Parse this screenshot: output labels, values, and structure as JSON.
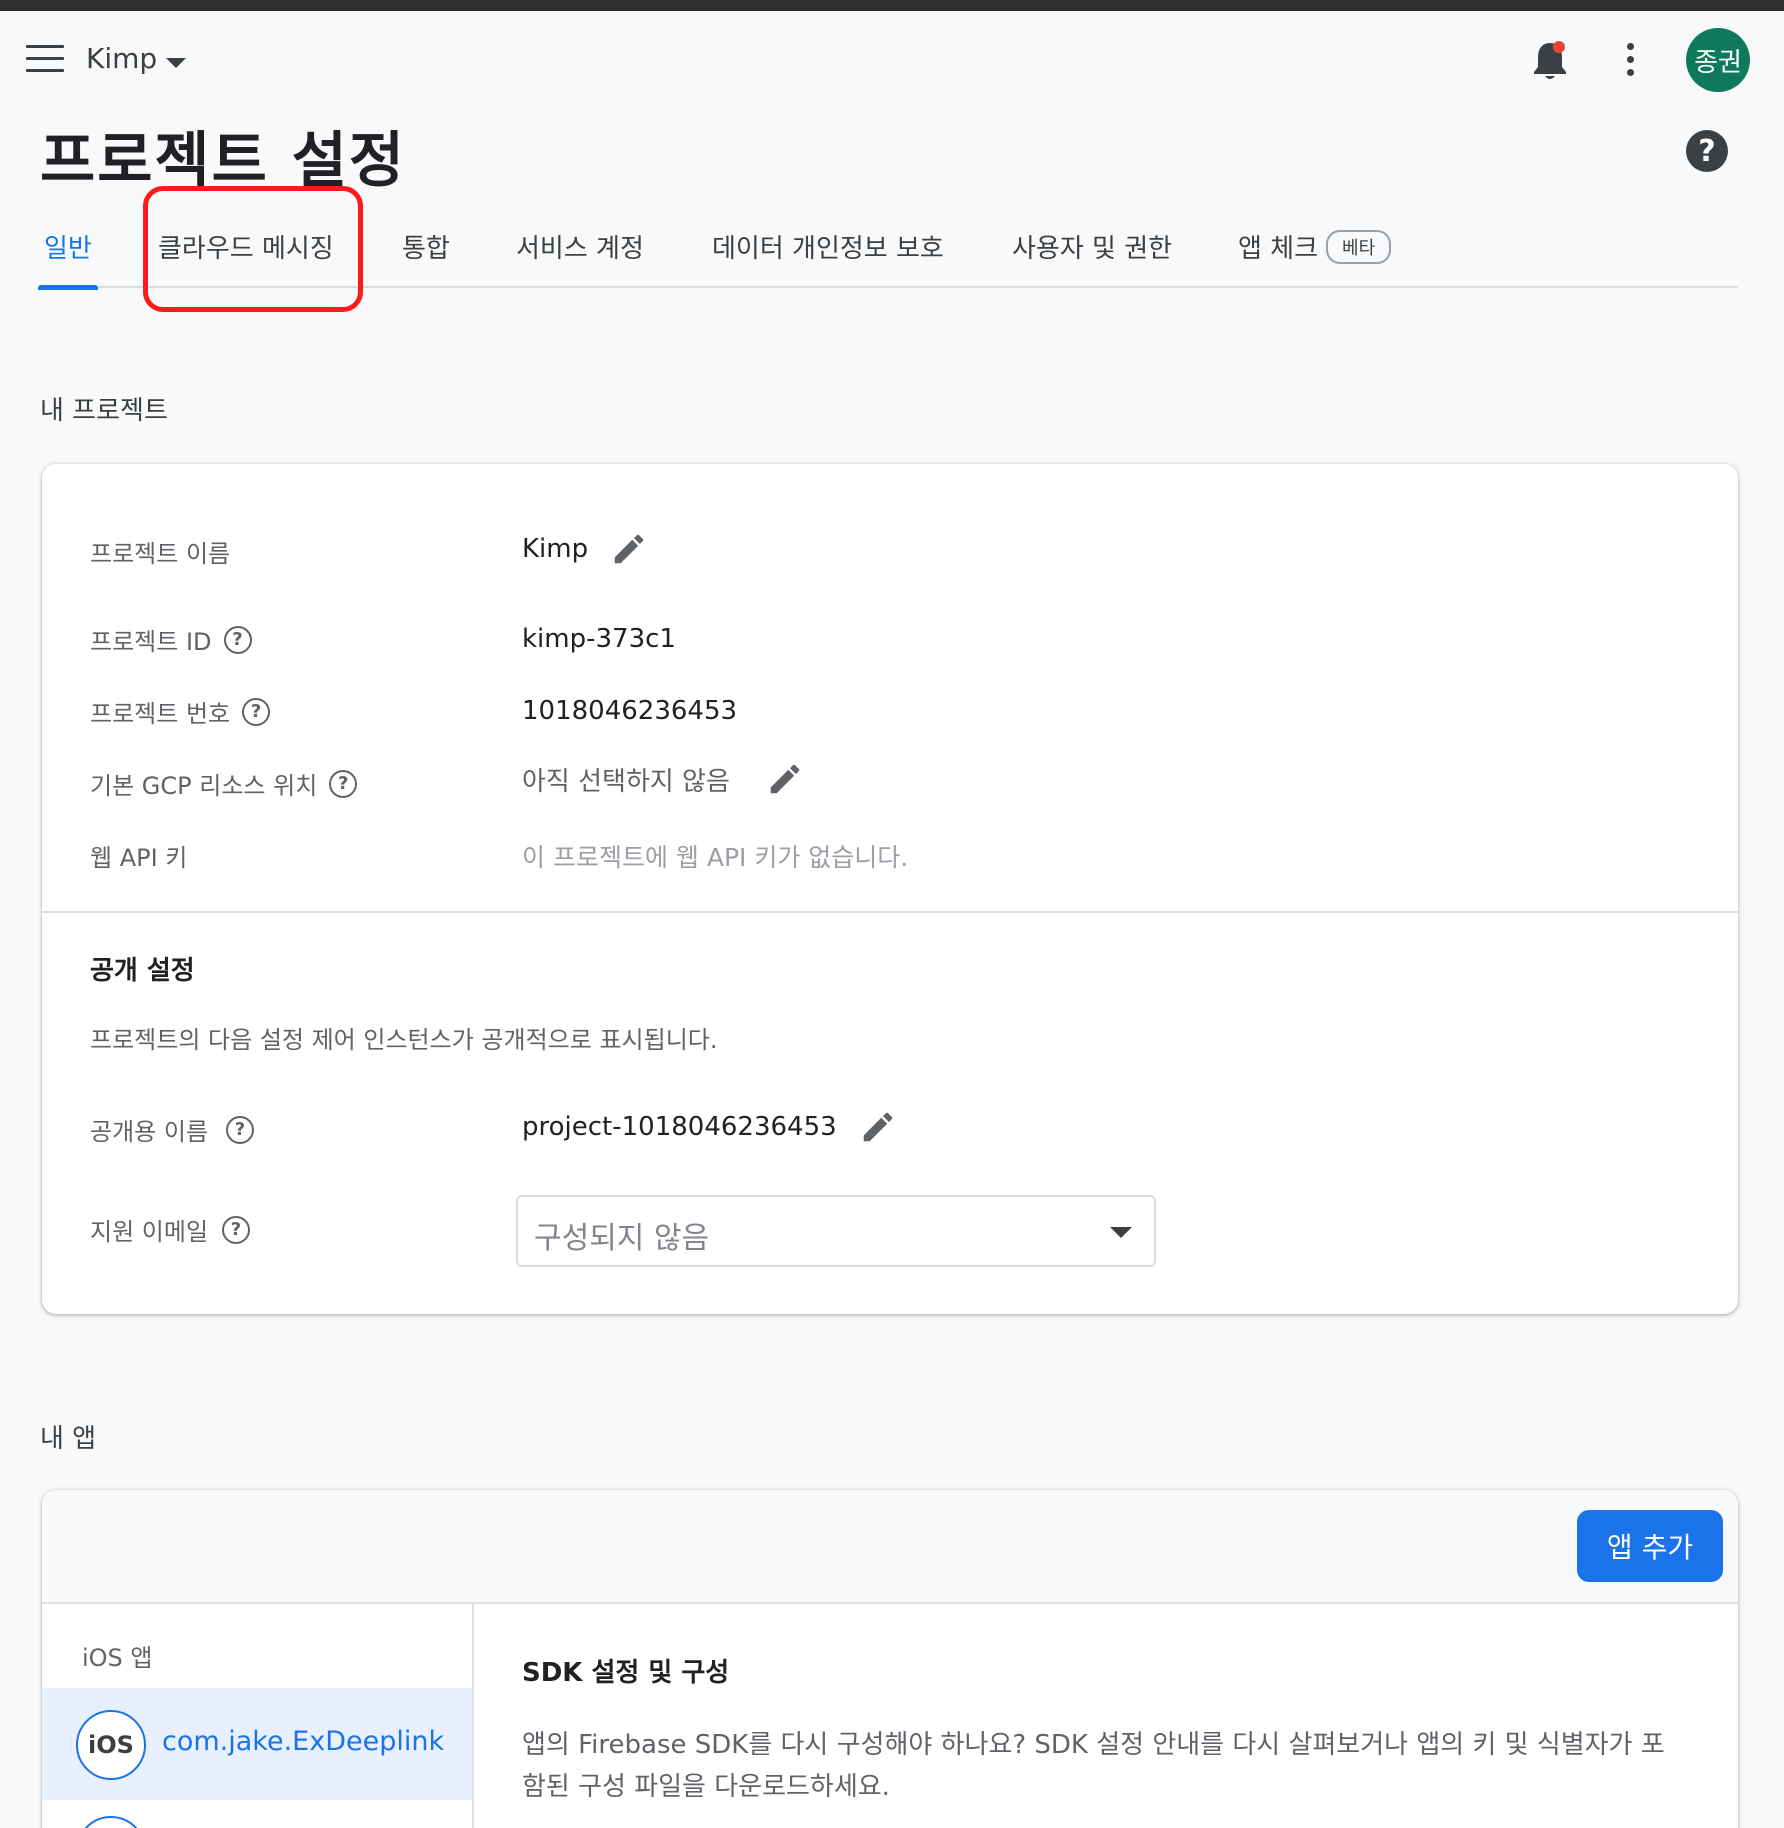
{
  "header": {
    "project_name": "Kimp",
    "avatar_text": "종권",
    "notification_dot_color": "#ea4335"
  },
  "page": {
    "title": "프로젝트 설정",
    "help_glyph": "?"
  },
  "tabs": [
    {
      "label": "일반",
      "active": true
    },
    {
      "label": "클라우드 메시징",
      "highlighted": true
    },
    {
      "label": "통합"
    },
    {
      "label": "서비스 계정"
    },
    {
      "label": "데이터 개인정보 보호"
    },
    {
      "label": "사용자 및 권한"
    },
    {
      "label": "앱 체크",
      "badge": "베타"
    }
  ],
  "my_project": {
    "section_label": "내 프로젝트",
    "rows": {
      "name": {
        "label": "프로젝트 이름",
        "value": "Kimp"
      },
      "id": {
        "label": "프로젝트 ID",
        "value": "kimp-373c1"
      },
      "number": {
        "label": "프로젝트 번호",
        "value": "1018046236453"
      },
      "gcp_location": {
        "label": "기본 GCP 리소스 위치",
        "value": "아직 선택하지 않음"
      },
      "web_api_key": {
        "label": "웹 API 키",
        "value": "이 프로젝트에 웹 API 키가 없습니다."
      }
    },
    "public": {
      "title": "공개 설정",
      "description": "프로젝트의 다음 설정 제어 인스턴스가 공개적으로 표시됩니다.",
      "public_name": {
        "label": "공개용 이름",
        "value": "project-1018046236453"
      },
      "support_email": {
        "label": "지원 이메일",
        "placeholder": "구성되지 않음"
      }
    }
  },
  "my_apps": {
    "section_label": "내 앱",
    "add_button": "앱 추가",
    "platform_label": "iOS 앱",
    "app_badge": "iOS",
    "app_name": "com.jake.ExDeeplink",
    "sdk_title": "SDK 설정 및 구성",
    "sdk_description": "앱의 Firebase SDK를 다시 구성해야 하나요? SDK 설정 안내를 다시 살펴보거나 앱의 키 및 식별자가 포함된 구성 파일을 다운로드하세요."
  },
  "colors": {
    "accent": "#1a73e8",
    "highlight": "#ff1a1a",
    "avatar_bg": "#0f7a5a"
  }
}
